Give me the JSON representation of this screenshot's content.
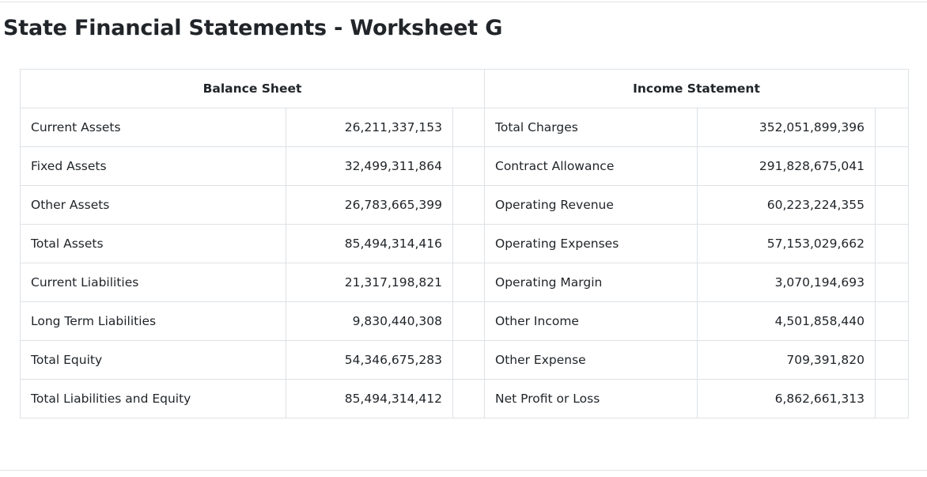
{
  "page": {
    "title": "State Financial Statements - Worksheet G"
  },
  "balance_sheet": {
    "header": "Balance Sheet",
    "rows": [
      {
        "label": "Current Assets",
        "value": "26,211,337,153"
      },
      {
        "label": "Fixed Assets",
        "value": "32,499,311,864"
      },
      {
        "label": "Other Assets",
        "value": "26,783,665,399"
      },
      {
        "label": "Total Assets",
        "value": "85,494,314,416"
      },
      {
        "label": "Current Liabilities",
        "value": "21,317,198,821"
      },
      {
        "label": "Long Term Liabilities",
        "value": "9,830,440,308"
      },
      {
        "label": "Total Equity",
        "value": "54,346,675,283"
      },
      {
        "label": "Total Liabilities and Equity",
        "value": "85,494,314,412"
      }
    ]
  },
  "income_statement": {
    "header": "Income Statement",
    "rows": [
      {
        "label": "Total Charges",
        "value": "352,051,899,396"
      },
      {
        "label": "Contract Allowance",
        "value": "291,828,675,041"
      },
      {
        "label": "Operating Revenue",
        "value": "60,223,224,355"
      },
      {
        "label": "Operating Expenses",
        "value": "57,153,029,662"
      },
      {
        "label": "Operating Margin",
        "value": "3,070,194,693"
      },
      {
        "label": "Other Income",
        "value": "4,501,858,440"
      },
      {
        "label": "Other Expense",
        "value": "709,391,820"
      },
      {
        "label": "Net Profit or Loss",
        "value": "6,862,661,313"
      }
    ]
  },
  "colors": {
    "text": "#212529",
    "border": "#dee2e6",
    "rule": "#e3e3e3",
    "background": "#ffffff"
  }
}
